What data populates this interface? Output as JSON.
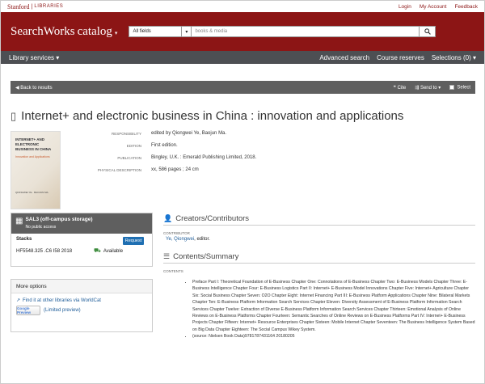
{
  "topbar": {
    "logo_stanford": "Stanford",
    "logo_libraries": "LIBRARIES",
    "links": [
      "Login",
      "My Account",
      "Feedback"
    ]
  },
  "masthead": {
    "brand": "SearchWorks",
    "brand_catalog": "catalog",
    "brand_caret": "▾",
    "search_field": "All fields",
    "search_placeholder": "books & media"
  },
  "nav": {
    "left": "Library services",
    "right": [
      "Advanced search",
      "Course reserves",
      "Selections (0)"
    ]
  },
  "toolbar": {
    "back": "Back to results",
    "cite": "Cite",
    "send": "Send to",
    "select": "Select"
  },
  "record": {
    "title": "Internet+ and electronic business in China : innovation and applications",
    "cover": {
      "title": "INTERNET+ AND ELECTRONIC BUSINESS IN CHINA",
      "subtitle": "Innovation and Applications",
      "authors": "QIONGWEI YE · BAOJUN MA"
    },
    "meta": [
      {
        "key": "RESPONSIBILITY",
        "value": "edited by Qiongwei Ye, Baojun Ma."
      },
      {
        "key": "EDITION",
        "value": "First edition."
      },
      {
        "key": "PUBLICATION",
        "value": "Bingley, U.K. : Emerald Publishing Limited, 2018."
      },
      {
        "key": "PHYSICAL DESCRIPTION",
        "value": "xx, 586 pages ; 24 cm"
      }
    ]
  },
  "availability": {
    "location": "SAL3 (off-campus storage)",
    "note": "No public access",
    "stacks": "Stacks",
    "request": "Request",
    "callnumber": "HF5548.325 .C6 I58 2018",
    "status": "Available"
  },
  "more_options": {
    "header": "More options",
    "worldcat": "Find it at other libraries via WorldCat",
    "google_btn": "Google Preview",
    "limited": "(Limited preview)"
  },
  "creators": {
    "header": "Creators/Contributors",
    "label": "CONTRIBUTOR",
    "name": "Ye, Qiongwei",
    "role": ", editor."
  },
  "contents": {
    "header": "Contents/Summary",
    "label": "CONTENTS",
    "items": [
      "Preface Part I: Theoretical Foundation of E-Business Chapter One: Connotations of E-Business Chapter Two: E-Business Models Chapter Three: E-Business Intelligence Chapter Four: E-Business Logistics Part II: Internet+ E-Business Model Innovations Chapter Five: Internet+ Agriculture Chapter Six: Social Business Chapter Seven: O2O Chapter Eight: Internet Financing Part III: E-Business Platform Applications Chapter Nine: Bilateral Markets Chapter Ten: E-Business Platform Information Search Services Chapter Eleven: Diversity Assessment of E-Business Platform Information Search Services Chapter Twelve: Extraction of Diverse E-Business Platform Information Search Services Chapter Thirteen: Emotional Analysis of Online Reviews on E-Business Platforms Chapter Fourteen: Semantic Searches of Online Reviews on E-Business Platforms Part IV: Internet+ E-Business Projects Chapter Fifteen: Internet+ Resource Enterprises Chapter Sixteen: Mobile Internet Chapter Seventeen: The Business Intelligence System Based on Big Data Chapter Eighteen: The Social Campus Wikey System.",
      "(source: Nielsen Book Data)9781787431164 20180205"
    ]
  }
}
